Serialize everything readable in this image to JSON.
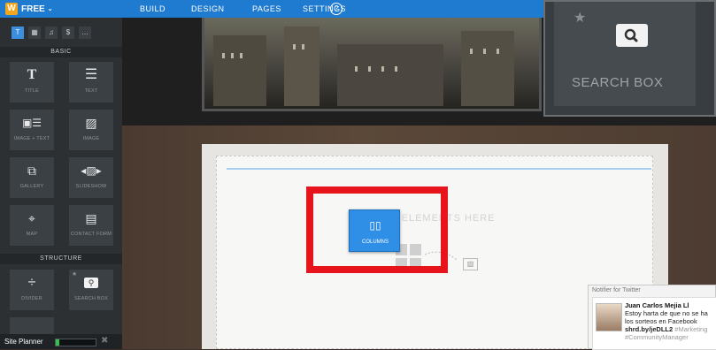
{
  "topbar": {
    "plan_label": "FREE",
    "nav": [
      "BUILD",
      "DESIGN",
      "PAGES",
      "SETTINGS"
    ]
  },
  "sidebar": {
    "tabs": [
      "T",
      "▦",
      "♫",
      "$",
      "…"
    ],
    "basic_header": "BASIC",
    "basic_items": [
      {
        "label": "TITLE",
        "icon": "title-icon"
      },
      {
        "label": "TEXT",
        "icon": "text-icon"
      },
      {
        "label": "IMAGE + TEXT",
        "icon": "image-text-icon"
      },
      {
        "label": "IMAGE",
        "icon": "image-icon"
      },
      {
        "label": "GALLERY",
        "icon": "gallery-icon"
      },
      {
        "label": "SLIDESHOW",
        "icon": "slideshow-icon"
      },
      {
        "label": "MAP",
        "icon": "map-icon"
      },
      {
        "label": "CONTACT FORM",
        "icon": "contact-form-icon"
      }
    ],
    "structure_header": "STRUCTURE",
    "structure_items": [
      {
        "label": "DIVIDER",
        "icon": "divider-icon"
      },
      {
        "label": "SEARCH BOX",
        "icon": "search-icon"
      }
    ],
    "site_planner_label": "Site Planner",
    "site_planner_progress": 0.08
  },
  "zoom": {
    "label": "SEARCH BOX"
  },
  "canvas": {
    "drop_hint": "G ELEMENTS HERE",
    "drag_element_label": "COLUMNS"
  },
  "notifier": {
    "title": "Notifier for Twitter",
    "name": "Juan Carlos Mejia Ll",
    "line1": "Estoy harta de que no se ha",
    "line2": "los sorteos en Facebook",
    "line3_link": "shrd.by/jeDLL2",
    "line3_hash": "#Marketing",
    "line4_hash": "#CommunityManager"
  },
  "colors": {
    "accent_blue": "#1f7bd0",
    "highlight_red": "#e8141b",
    "progress_green": "#33c24d"
  }
}
